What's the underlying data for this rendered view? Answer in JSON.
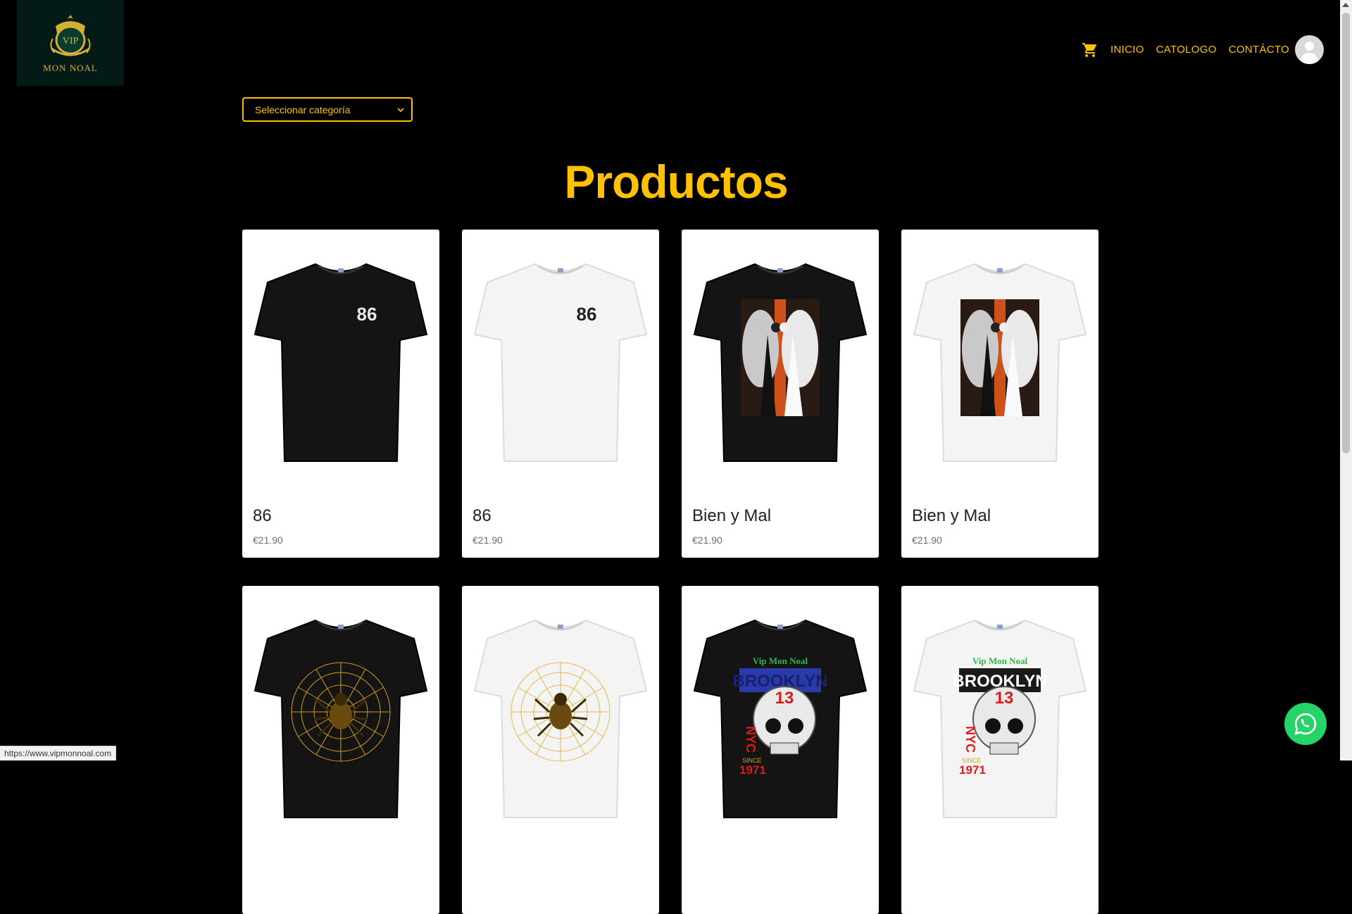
{
  "header": {
    "logo": {
      "top_text": "VIP",
      "brand_text": "MON NOAL"
    },
    "nav": {
      "home": "INICIO",
      "catalog": "CATOLOGO",
      "contact": "CONTÁCTO"
    }
  },
  "filter": {
    "selected": "Seleccionar categoría"
  },
  "page_title": "Productos",
  "products": [
    {
      "name": "86",
      "price": "€21.90",
      "shirt": "black",
      "print": "86"
    },
    {
      "name": "86",
      "price": "€21.90",
      "shirt": "white",
      "print": "86"
    },
    {
      "name": "Bien y Mal",
      "price": "€21.90",
      "shirt": "black",
      "print": "angels"
    },
    {
      "name": "Bien y Mal",
      "price": "€21.90",
      "shirt": "white",
      "print": "angels"
    },
    {
      "name": "",
      "price": "",
      "shirt": "black",
      "print": "spider"
    },
    {
      "name": "",
      "price": "",
      "shirt": "white",
      "print": "spider"
    },
    {
      "name": "",
      "price": "",
      "shirt": "black",
      "print": "skull-brooklyn"
    },
    {
      "name": "",
      "price": "",
      "shirt": "white",
      "print": "skull-brooklyn"
    }
  ],
  "skull_print_text": {
    "brand": "Vip Mon Noal",
    "city": "BROOKLYN",
    "number": "13",
    "side": "NYC",
    "since": "SINCE",
    "year": "1971"
  },
  "status_url": "https://www.vipmonnoal.com",
  "colors": {
    "accent": "#ffc107",
    "background": "#000000",
    "whatsapp": "#25d366"
  },
  "icons": [
    "cart-icon",
    "avatar-icon",
    "chevron-down-icon",
    "whatsapp-icon"
  ]
}
